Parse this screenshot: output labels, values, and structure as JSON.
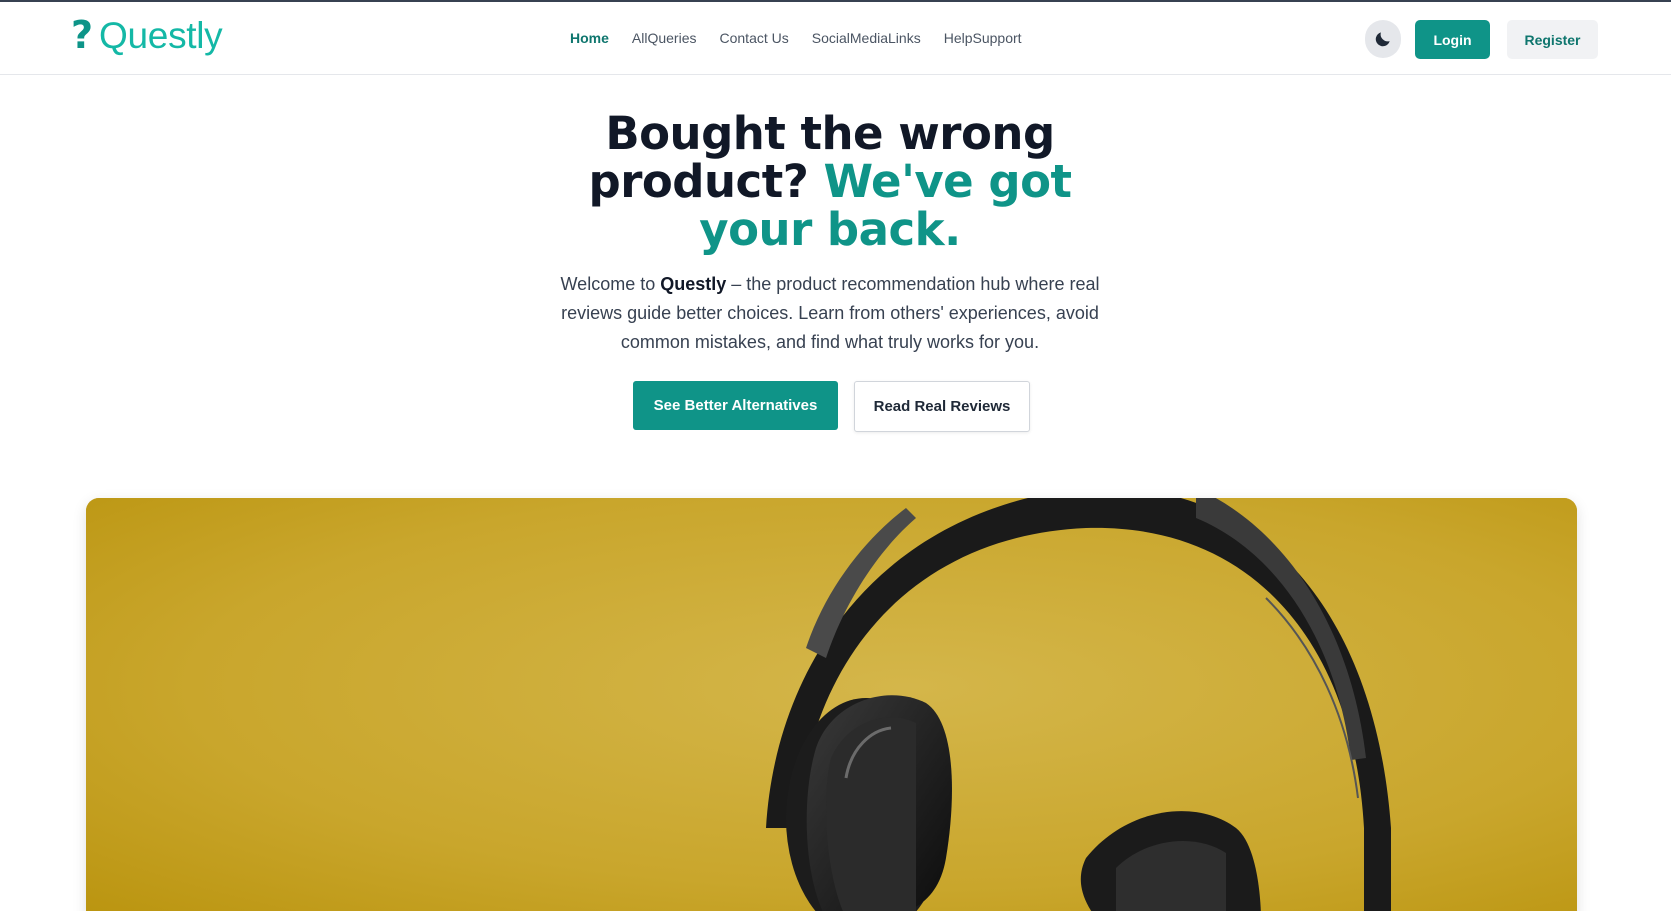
{
  "brand": {
    "icon": "question-mark-icon",
    "icon_glyph": "?",
    "name": "Questly"
  },
  "nav": {
    "items": [
      {
        "label": "Home",
        "active": true
      },
      {
        "label": "AllQueries",
        "active": false
      },
      {
        "label": "Contact Us",
        "active": false
      },
      {
        "label": "SocialMediaLinks",
        "active": false
      },
      {
        "label": "HelpSupport",
        "active": false
      }
    ]
  },
  "header_actions": {
    "theme_toggle_icon": "moon-icon",
    "login_label": "Login",
    "register_label": "Register"
  },
  "hero": {
    "title_part1": "Bought the wrong product?",
    "title_accent": "We've got your back.",
    "subtitle_prefix": "Welcome to ",
    "subtitle_brand": "Questly",
    "subtitle_rest": " – the product recommendation hub where real reviews guide better choices. Learn from others' experiences, avoid common mistakes, and find what truly works for you.",
    "primary_button": "See Better Alternatives",
    "secondary_button": "Read Real Reviews",
    "image": "headphones-on-yellow-background"
  },
  "colors": {
    "accent": "#0f9488",
    "brand_text": "#14b8a6",
    "hero_image_bg": "#c9a41a",
    "heading": "#111827"
  }
}
